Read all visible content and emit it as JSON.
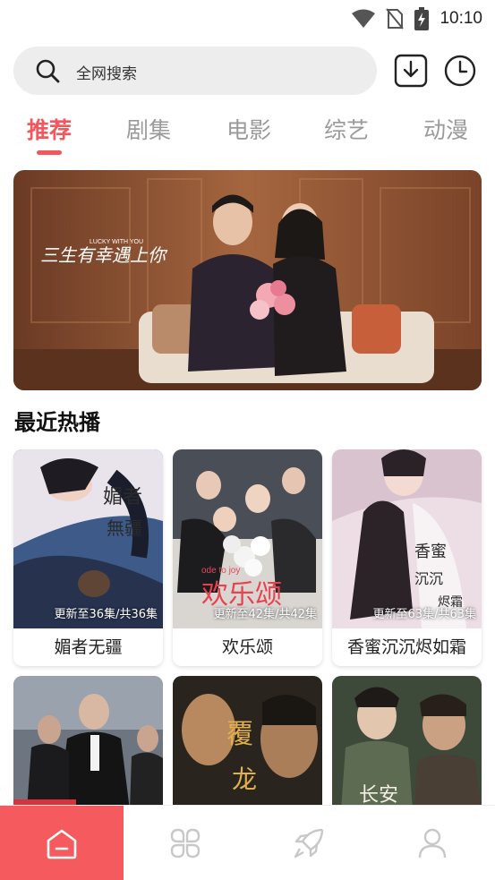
{
  "status": {
    "time": "10:10"
  },
  "search": {
    "placeholder": "全网搜索"
  },
  "tabs": [
    {
      "label": "推荐",
      "active": true
    },
    {
      "label": "剧集",
      "active": false
    },
    {
      "label": "电影",
      "active": false
    },
    {
      "label": "综艺",
      "active": false
    },
    {
      "label": "动漫",
      "active": false
    }
  ],
  "banner": {
    "caption": "三生有幸遇上你",
    "subcaption": "LUCKY WITH YOU"
  },
  "section": {
    "title": "最近热播"
  },
  "cards": [
    {
      "title": "媚者无疆",
      "badge": "更新至36集/共36集"
    },
    {
      "title": "欢乐颂",
      "badge": "更新至42集/共42集",
      "poster_text": "欢乐颂",
      "poster_sub": "ode to joy"
    },
    {
      "title": "香蜜沉沉烬如霜",
      "badge": "更新至63集/共63集"
    }
  ],
  "colors": {
    "accent": "#f0585e",
    "nav_active": "#f55b5e"
  },
  "icons": {
    "search": "search-icon",
    "download": "download-icon",
    "history": "clock-icon",
    "nav": [
      "home-icon",
      "category-icon",
      "rocket-icon",
      "user-icon"
    ]
  }
}
